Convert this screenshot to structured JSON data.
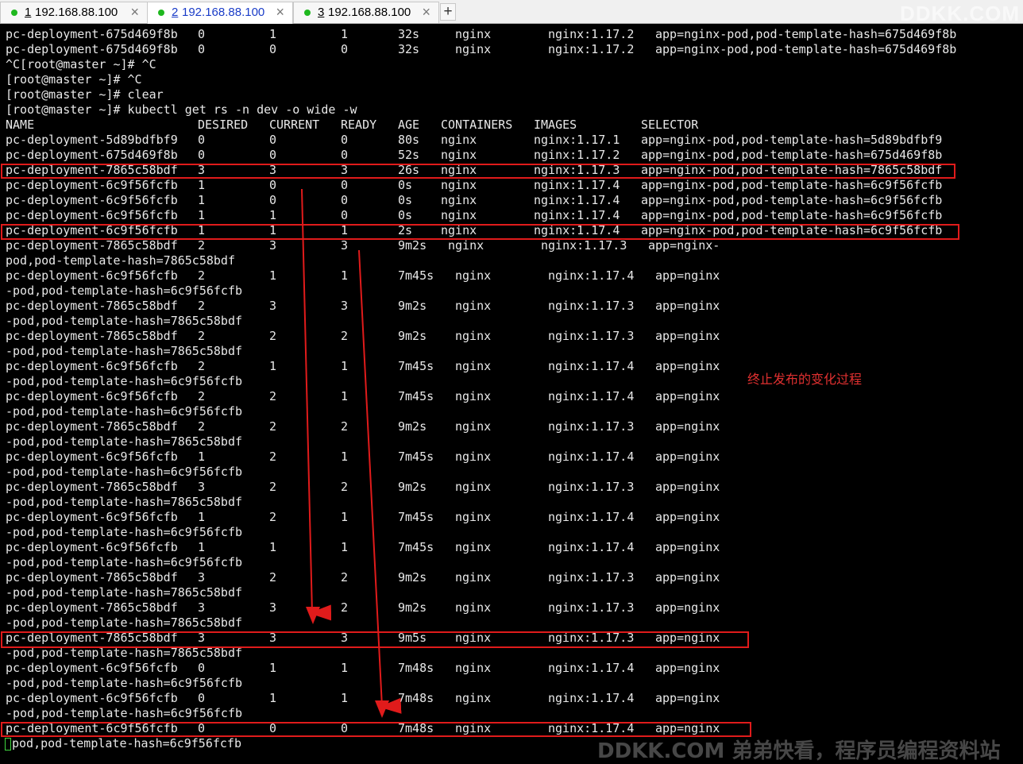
{
  "tabs": [
    {
      "num": "1",
      "title": "192.168.88.100",
      "active": false
    },
    {
      "num": "2",
      "title": "192.168.88.100",
      "active": true
    },
    {
      "num": "3",
      "title": "192.168.88.100",
      "active": false
    }
  ],
  "new_tab_label": "+",
  "watermark_top": "DDKK.COM",
  "terminal": {
    "pre_lines_top": [
      [
        "pc-deployment-675d469f8b",
        "0",
        "1",
        "1",
        "32s",
        "nginx",
        "nginx:1.17.2",
        "app=nginx-pod,pod-template-hash=675d469f8b"
      ],
      [
        "pc-deployment-675d469f8b",
        "0",
        "0",
        "0",
        "32s",
        "nginx",
        "nginx:1.17.2",
        "app=nginx-pod,pod-template-hash=675d469f8b"
      ]
    ],
    "prompt_lines": [
      "^C[root@master ~]# ^C",
      "[root@master ~]# ^C",
      "[root@master ~]# clear",
      "[root@master ~]# kubectl get rs -n dev -o wide -w"
    ],
    "header": [
      "NAME",
      "DESIRED",
      "CURRENT",
      "READY",
      "AGE",
      "CONTAINERS",
      "IMAGES",
      "SELECTOR"
    ],
    "rows_a": [
      [
        "pc-deployment-5d89bdfbf9",
        "0",
        "0",
        "0",
        "80s",
        "nginx",
        "nginx:1.17.1",
        "app=nginx-pod,pod-template-hash=5d89bdfbf9"
      ],
      [
        "pc-deployment-675d469f8b",
        "0",
        "0",
        "0",
        "52s",
        "nginx",
        "nginx:1.17.2",
        "app=nginx-pod,pod-template-hash=675d469f8b"
      ],
      [
        "pc-deployment-7865c58bdf",
        "3",
        "3",
        "3",
        "26s",
        "nginx",
        "nginx:1.17.3",
        "app=nginx-pod,pod-template-hash=7865c58bdf"
      ],
      [
        "pc-deployment-6c9f56fcfb",
        "1",
        "0",
        "0",
        "0s",
        "nginx",
        "nginx:1.17.4",
        "app=nginx-pod,pod-template-hash=6c9f56fcfb"
      ],
      [
        "pc-deployment-6c9f56fcfb",
        "1",
        "0",
        "0",
        "0s",
        "nginx",
        "nginx:1.17.4",
        "app=nginx-pod,pod-template-hash=6c9f56fcfb"
      ],
      [
        "pc-deployment-6c9f56fcfb",
        "1",
        "1",
        "0",
        "0s",
        "nginx",
        "nginx:1.17.4",
        "app=nginx-pod,pod-template-hash=6c9f56fcfb"
      ],
      [
        "pc-deployment-6c9f56fcfb",
        "1",
        "1",
        "1",
        "2s",
        "nginx",
        "nginx:1.17.4",
        "app=nginx-pod,pod-template-hash=6c9f56fcfb"
      ]
    ],
    "row_b": [
      "pc-deployment-7865c58bdf",
      "2",
      "3",
      "3",
      "9m2s",
      "nginx",
      "nginx:1.17.3",
      "app=nginx-"
    ],
    "row_b_wrap": "pod,pod-template-hash=7865c58bdf",
    "rows_c": [
      [
        "pc-deployment-6c9f56fcfb",
        "2",
        "1",
        "1",
        "7m45s",
        "nginx",
        "nginx:1.17.4",
        "app=nginx",
        "-pod,pod-template-hash=6c9f56fcfb"
      ],
      [
        "pc-deployment-7865c58bdf",
        "2",
        "3",
        "3",
        "9m2s",
        "nginx",
        "nginx:1.17.3",
        "app=nginx",
        "-pod,pod-template-hash=7865c58bdf"
      ],
      [
        "pc-deployment-7865c58bdf",
        "2",
        "2",
        "2",
        "9m2s",
        "nginx",
        "nginx:1.17.3",
        "app=nginx",
        "-pod,pod-template-hash=7865c58bdf"
      ],
      [
        "pc-deployment-6c9f56fcfb",
        "2",
        "1",
        "1",
        "7m45s",
        "nginx",
        "nginx:1.17.4",
        "app=nginx",
        "-pod,pod-template-hash=6c9f56fcfb"
      ],
      [
        "pc-deployment-6c9f56fcfb",
        "2",
        "2",
        "1",
        "7m45s",
        "nginx",
        "nginx:1.17.4",
        "app=nginx",
        "-pod,pod-template-hash=6c9f56fcfb"
      ],
      [
        "pc-deployment-7865c58bdf",
        "2",
        "2",
        "2",
        "9m2s",
        "nginx",
        "nginx:1.17.3",
        "app=nginx",
        "-pod,pod-template-hash=7865c58bdf"
      ],
      [
        "pc-deployment-6c9f56fcfb",
        "1",
        "2",
        "1",
        "7m45s",
        "nginx",
        "nginx:1.17.4",
        "app=nginx",
        "-pod,pod-template-hash=6c9f56fcfb"
      ],
      [
        "pc-deployment-7865c58bdf",
        "3",
        "2",
        "2",
        "9m2s",
        "nginx",
        "nginx:1.17.3",
        "app=nginx",
        "-pod,pod-template-hash=7865c58bdf"
      ],
      [
        "pc-deployment-6c9f56fcfb",
        "1",
        "2",
        "1",
        "7m45s",
        "nginx",
        "nginx:1.17.4",
        "app=nginx",
        "-pod,pod-template-hash=6c9f56fcfb"
      ],
      [
        "pc-deployment-6c9f56fcfb",
        "1",
        "1",
        "1",
        "7m45s",
        "nginx",
        "nginx:1.17.4",
        "app=nginx",
        "-pod,pod-template-hash=6c9f56fcfb"
      ],
      [
        "pc-deployment-7865c58bdf",
        "3",
        "2",
        "2",
        "9m2s",
        "nginx",
        "nginx:1.17.3",
        "app=nginx",
        "-pod,pod-template-hash=7865c58bdf"
      ],
      [
        "pc-deployment-7865c58bdf",
        "3",
        "3",
        "2",
        "9m2s",
        "nginx",
        "nginx:1.17.3",
        "app=nginx",
        "-pod,pod-template-hash=7865c58bdf"
      ],
      [
        "pc-deployment-7865c58bdf",
        "3",
        "3",
        "3",
        "9m5s",
        "nginx",
        "nginx:1.17.3",
        "app=nginx",
        "-pod,pod-template-hash=7865c58bdf"
      ],
      [
        "pc-deployment-6c9f56fcfb",
        "0",
        "1",
        "1",
        "7m48s",
        "nginx",
        "nginx:1.17.4",
        "app=nginx",
        "-pod,pod-template-hash=6c9f56fcfb"
      ],
      [
        "pc-deployment-6c9f56fcfb",
        "0",
        "1",
        "1",
        "7m48s",
        "nginx",
        "nginx:1.17.4",
        "app=nginx",
        "-pod,pod-template-hash=6c9f56fcfb"
      ],
      [
        "pc-deployment-6c9f56fcfb",
        "0",
        "0",
        "0",
        "7m48s",
        "nginx",
        "nginx:1.17.4",
        "app=nginx",
        "pod,pod-template-hash=6c9f56fcfb"
      ]
    ]
  },
  "annotation_note": "终止发布的变化过程",
  "watermark_bottom": "DDKK.COM 弟弟快看，程序员编程资料站",
  "colors": {
    "highlight": "#e01b1b",
    "terminal_bg": "#000000",
    "terminal_fg": "#e8e8e8",
    "active_tab_text": "#1a3cc8",
    "status_dot": "#1fb81f"
  }
}
